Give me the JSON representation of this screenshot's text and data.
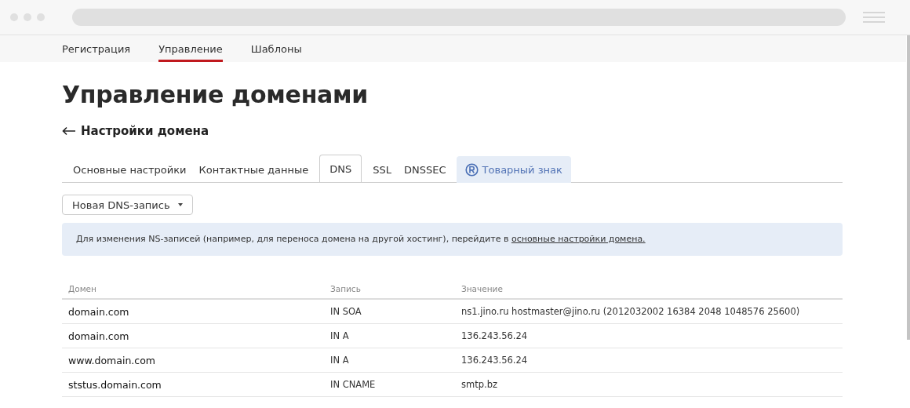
{
  "nav": [
    {
      "label": "Регистрация",
      "selected": false
    },
    {
      "label": "Управление",
      "selected": true
    },
    {
      "label": "Шаблоны",
      "selected": false
    }
  ],
  "page_title": "Управление доменами",
  "back_link": "Настройки домена",
  "tabs": [
    {
      "label": "Основные настройки",
      "selected": false,
      "kind": "plain"
    },
    {
      "label": "Контактные данные",
      "selected": false,
      "kind": "plain"
    },
    {
      "label": "DNS",
      "selected": true,
      "kind": "plain"
    },
    {
      "label": "SSL",
      "selected": false,
      "kind": "plain"
    },
    {
      "label": "DNSSEC",
      "selected": false,
      "kind": "plain"
    },
    {
      "label": "Товарный знак",
      "selected": false,
      "kind": "trademark"
    }
  ],
  "new_record_button": "Новая DNS-запись",
  "notice": {
    "text": "Для изменения NS-записей (например, для переноса домена на другой хостинг), перейдите в",
    "link": "основные настройки домена."
  },
  "table": {
    "columns": [
      "Домен",
      "Запись",
      "Значение"
    ],
    "rows": [
      [
        "domain.com",
        "IN SOA",
        "ns1.jino.ru hostmaster@jino.ru (2012032002 16384 2048 1048576 25600)"
      ],
      [
        "domain.com",
        "IN A",
        "136.243.56.24"
      ],
      [
        "www.domain.com",
        "IN A",
        "136.243.56.24"
      ],
      [
        "ststus.domain.com",
        "IN CNAME",
        "smtp.bz"
      ]
    ]
  }
}
